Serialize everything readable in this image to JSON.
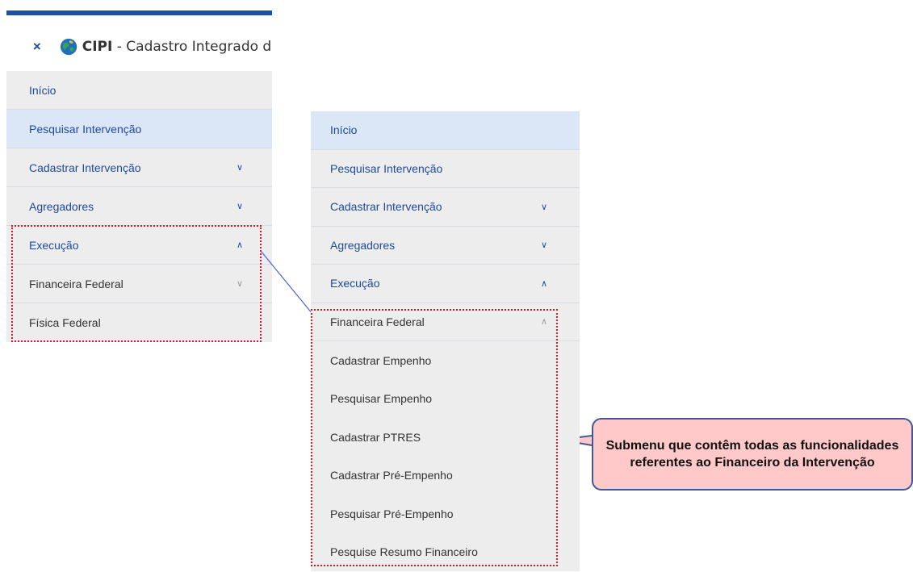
{
  "app": {
    "close_symbol": "×",
    "title_bold": "CIPI",
    "title_rest": " - Cadastro Integrado de I"
  },
  "left_menu": [
    {
      "label": "Início",
      "chevron": ""
    },
    {
      "label": "Pesquisar Intervenção",
      "chevron": ""
    },
    {
      "label": "Cadastrar Intervenção",
      "chevron": "∨"
    },
    {
      "label": "Agregadores",
      "chevron": "∨"
    },
    {
      "label": "Execução",
      "chevron": "∧"
    },
    {
      "label": "Financeira Federal",
      "chevron": "∨"
    },
    {
      "label": "Física Federal",
      "chevron": ""
    }
  ],
  "right_menu": [
    {
      "label": "Início",
      "chevron": ""
    },
    {
      "label": "Pesquisar Intervenção",
      "chevron": ""
    },
    {
      "label": "Cadastrar Intervenção",
      "chevron": "∨"
    },
    {
      "label": "Agregadores",
      "chevron": "∨"
    },
    {
      "label": "Execução",
      "chevron": "∧"
    },
    {
      "label": "Financeira Federal",
      "chevron": "∧"
    },
    {
      "label": "Cadastrar Empenho",
      "chevron": ""
    },
    {
      "label": "Pesquisar Empenho",
      "chevron": ""
    },
    {
      "label": "Cadastrar PTRES",
      "chevron": ""
    },
    {
      "label": "Cadastrar Pré-Empenho",
      "chevron": ""
    },
    {
      "label": "Pesquisar Pré-Empenho",
      "chevron": ""
    },
    {
      "label": "Pesquise Resumo Financeiro",
      "chevron": ""
    }
  ],
  "callout": {
    "text": "Submenu que contêm todas as funcionalidades referentes ao Financeiro da Intervenção"
  },
  "colors": {
    "accent": "#1d4a9b",
    "active_bg": "#dbe7f7",
    "menu_bg": "#ededed",
    "highlight_dots": "#d71920",
    "callout_bg": "#ffc9c9"
  }
}
